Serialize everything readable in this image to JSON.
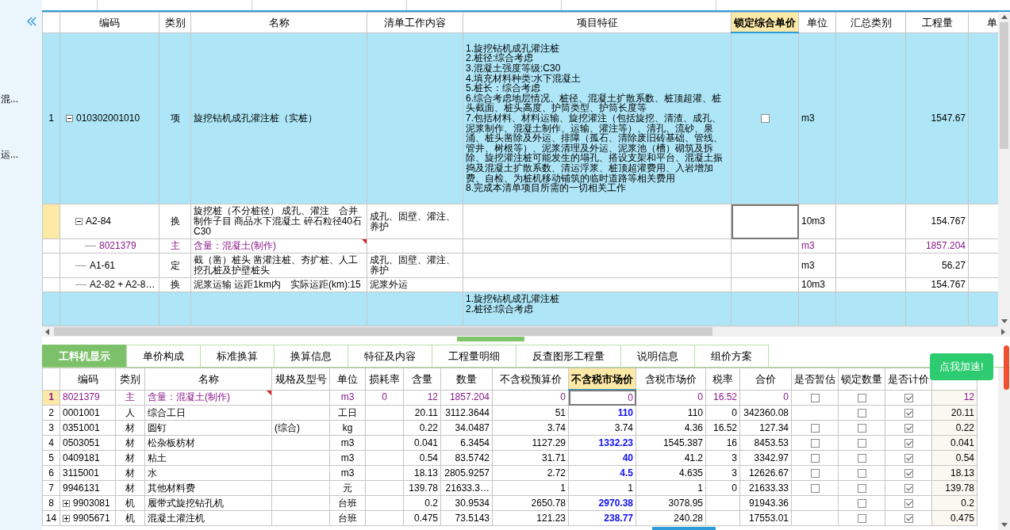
{
  "sidebar": {
    "items": [
      "混...",
      "运..."
    ]
  },
  "bill_table": {
    "columns": [
      {
        "highlighted": false
      },
      {
        "label": "编码",
        "highlighted": false
      },
      {
        "label": "类别",
        "highlighted": false
      },
      {
        "label": "名称",
        "highlighted": false
      },
      {
        "label": "清单工作内容",
        "highlighted": false
      },
      {
        "label": "项目特征",
        "highlighted": false
      },
      {
        "label": "锁定综合单价",
        "highlighted": true
      },
      {
        "label": "单位",
        "highlighted": false
      },
      {
        "label": "汇总类别",
        "highlighted": false
      },
      {
        "label": "工程量",
        "highlighted": false
      },
      {
        "label": "单",
        "highlighted": false
      }
    ],
    "rows": [
      {
        "kind": "item",
        "number": "1",
        "code": "010302001010",
        "expanded": true,
        "selected": false,
        "commented": false,
        "category": "项",
        "name": "旋挖钻机成孔灌注桩（实桩）",
        "features": [
          "1.旋挖钻机成孔灌注桩",
          "2.桩径:综合考虑",
          "3.混凝土强度等级:C30",
          "4.填充材料种类:水下混凝土",
          "5.桩长：综合考虑",
          "6.综合考虑地层情况、桩径、混凝土扩散系数、桩顶超灌、桩头截面、桩头高度、护筒类型、护筒长度等",
          "7.包括材料、材料运输、旋挖灌注（包括旋挖、清渣、成孔、泥浆制作、混凝土制作、运输、灌注等）、清孔、流砂、泉涌、桩头凿除及外运、排障（孤石、清除废旧砖基础、管线、管井、树根等）、泥浆清理及外运、泥浆池（槽）砌筑及拆除、旋挖灌注桩可能发生的塌孔、搭设支架和平台、混凝土振捣及混凝土扩散系数、清运浮浆、桩顶超灌费用、入岩增加费、自检、为桩机移动铺筑的临时道路等相关费用",
          "8.完成本清单项目所需的一切相关工作"
        ],
        "locked": false,
        "unit": "m3",
        "quantity": "1547.67",
        "children": [
          {
            "kind": "sub",
            "code": "A2-84",
            "expanded": true,
            "selected": true,
            "commented": false,
            "category": "换",
            "name": "旋挖桩（不分桩径） 成孔、灌注　合并制作子目 商品水下混凝土 碎石粒径40石 C30",
            "work_content": "成孔、固壁、灌注、养护",
            "unit": "10m3",
            "quantity": "154.767",
            "children": [
              {
                "kind": "material",
                "code": "8021379",
                "selected": false,
                "commented": true,
                "category": "主",
                "name": "含量：混凝土(制作)",
                "unit": "m3",
                "quantity": "1857.204"
              }
            ]
          },
          {
            "kind": "sub",
            "code": "A1-61",
            "selected": false,
            "commented": false,
            "category": "定",
            "name": "截（凿）桩头 凿灌注桩、夯扩桩、人工挖孔桩及护壁桩头",
            "work_content": "成孔、固壁、灌注、养护",
            "unit": "m3",
            "quantity": "56.27"
          },
          {
            "kind": "sub",
            "code": "A2-82 + A2-8…",
            "selected": false,
            "commented": false,
            "category": "换",
            "name": "泥浆运输 运距1km内　实际运距(km):15",
            "work_content": "泥浆外运",
            "unit": "10m3",
            "quantity": "154.767"
          }
        ]
      },
      {
        "kind": "item",
        "selected": false,
        "commented": false,
        "features": [
          "1.旋挖钻机成孔灌注桩",
          "2.桩径:综合考虑"
        ]
      }
    ]
  },
  "detail_tabs": [
    {
      "label": "工料机显示",
      "selected": true
    },
    {
      "label": "单价构成",
      "selected": false
    },
    {
      "label": "标准换算",
      "selected": false
    },
    {
      "label": "换算信息",
      "selected": false
    },
    {
      "label": "特征及内容",
      "selected": false
    },
    {
      "label": "工程量明细",
      "selected": false
    },
    {
      "label": "反查图形工程量",
      "selected": false
    },
    {
      "label": "说明信息",
      "selected": false
    },
    {
      "label": "组价方案",
      "selected": false
    }
  ],
  "resource_table": {
    "columns": [
      {
        "highlighted": false
      },
      {
        "label": "编码",
        "highlighted": false
      },
      {
        "label": "类别",
        "highlighted": false
      },
      {
        "label": "名称",
        "highlighted": false
      },
      {
        "label": "规格及型号",
        "highlighted": false
      },
      {
        "label": "单位",
        "highlighted": false
      },
      {
        "label": "损耗率",
        "highlighted": false
      },
      {
        "label": "含量",
        "highlighted": false
      },
      {
        "label": "数量",
        "highlighted": false
      },
      {
        "label": "不含税预算价",
        "highlighted": false
      },
      {
        "label": "不含税市场价",
        "highlighted": true
      },
      {
        "label": "含税市场价",
        "highlighted": false
      },
      {
        "label": "税率",
        "highlighted": false
      },
      {
        "label": "合价",
        "highlighted": false
      },
      {
        "label": "是否暂估",
        "highlighted": false
      },
      {
        "label": "锁定数量",
        "highlighted": false
      },
      {
        "label": "是否计价",
        "highlighted": false
      },
      {
        "highlighted": false
      }
    ],
    "rows": [
      {
        "kind": "main",
        "number": "1",
        "selected": true,
        "commented": true,
        "code": "8021379",
        "category": "主",
        "name": "含量：混凝土(制作)",
        "unit": "m3",
        "loss_rate": "0",
        "content": "12",
        "quantity": "1857.204",
        "budget_price": "0",
        "market_price": "0",
        "market_adjusted": false,
        "tax_price": "0",
        "tax_rate": "16.52",
        "total": "0",
        "provisional": false,
        "lock_quantity": false,
        "priced": true,
        "original_content": "12"
      },
      {
        "kind": "normal",
        "number": "2",
        "selected": false,
        "commented": false,
        "code": "0001001",
        "category": "人",
        "name": "综合工日",
        "unit": "工日",
        "content": "20.11",
        "quantity": "3112.3644",
        "budget_price": "51",
        "market_price": "110",
        "market_adjusted": true,
        "tax_price": "110",
        "tax_rate": "0",
        "total": "342360.08",
        "lock_quantity": false,
        "priced": true,
        "original_content": "20.11"
      },
      {
        "kind": "normal",
        "number": "3",
        "selected": false,
        "commented": false,
        "code": "0351001",
        "category": "材",
        "name": "圆钉",
        "spec": "(综合)",
        "unit": "kg",
        "content": "0.22",
        "quantity": "34.0487",
        "budget_price": "3.74",
        "market_price": "3.74",
        "market_adjusted": false,
        "tax_price": "4.36",
        "tax_rate": "16.52",
        "total": "127.34",
        "provisional": false,
        "lock_quantity": false,
        "priced": true,
        "original_content": "0.22"
      },
      {
        "kind": "normal",
        "number": "4",
        "selected": false,
        "commented": false,
        "code": "0503051",
        "category": "材",
        "name": "松杂板枋材",
        "unit": "m3",
        "content": "0.041",
        "quantity": "6.3454",
        "budget_price": "1127.29",
        "market_price": "1332.23",
        "market_adjusted": true,
        "tax_price": "1545.387",
        "tax_rate": "16",
        "total": "8453.53",
        "provisional": false,
        "lock_quantity": false,
        "priced": true,
        "original_content": "0.041"
      },
      {
        "kind": "normal",
        "number": "5",
        "selected": false,
        "commented": false,
        "code": "0409181",
        "category": "材",
        "name": "粘土",
        "unit": "m3",
        "content": "0.54",
        "quantity": "83.5742",
        "budget_price": "31.71",
        "market_price": "40",
        "market_adjusted": true,
        "tax_price": "41.2",
        "tax_rate": "3",
        "total": "3342.97",
        "provisional": false,
        "lock_quantity": false,
        "priced": true,
        "original_content": "0.54"
      },
      {
        "kind": "normal",
        "number": "6",
        "selected": false,
        "commented": false,
        "code": "3115001",
        "category": "材",
        "name": "水",
        "unit": "m3",
        "content": "18.13",
        "quantity": "2805.9257",
        "budget_price": "2.72",
        "market_price": "4.5",
        "market_adjusted": true,
        "tax_price": "4.635",
        "tax_rate": "3",
        "total": "12626.67",
        "provisional": false,
        "lock_quantity": false,
        "priced": true,
        "original_content": "18.13"
      },
      {
        "kind": "normal",
        "number": "7",
        "selected": false,
        "commented": false,
        "code": "9946131",
        "category": "材",
        "name": "其他材料费",
        "unit": "元",
        "content": "139.78",
        "quantity": "21633.3…",
        "budget_price": "1",
        "market_price": "1",
        "market_adjusted": false,
        "tax_price": "1",
        "tax_rate": "0",
        "total": "21633.33",
        "provisional": false,
        "lock_quantity": false,
        "priced": true,
        "original_content": "139.78"
      },
      {
        "kind": "normal",
        "number": "8",
        "selected": false,
        "commented": false,
        "expanded": false,
        "code": "9903081",
        "category": "机",
        "name": "履带式旋挖钻孔机",
        "unit": "台班",
        "content": "0.2",
        "quantity": "30.9534",
        "budget_price": "2650.78",
        "market_price": "2970.38",
        "market_adjusted": true,
        "tax_price": "3078.95",
        "total": "91943.36",
        "lock_quantity": false,
        "priced": true,
        "original_content": "0.2"
      },
      {
        "kind": "normal",
        "number": "14",
        "selected": false,
        "commented": false,
        "expanded": false,
        "code": "9905671",
        "category": "机",
        "name": "混凝土灌注机",
        "unit": "台班",
        "content": "0.475",
        "quantity": "73.5143",
        "budget_price": "121.23",
        "market_price": "238.77",
        "market_adjusted": true,
        "tax_price": "240.28",
        "total": "17553.01",
        "lock_quantity": false,
        "priced": true,
        "original_content": "0.475"
      }
    ]
  },
  "popup": {
    "label": "点我加速!"
  }
}
